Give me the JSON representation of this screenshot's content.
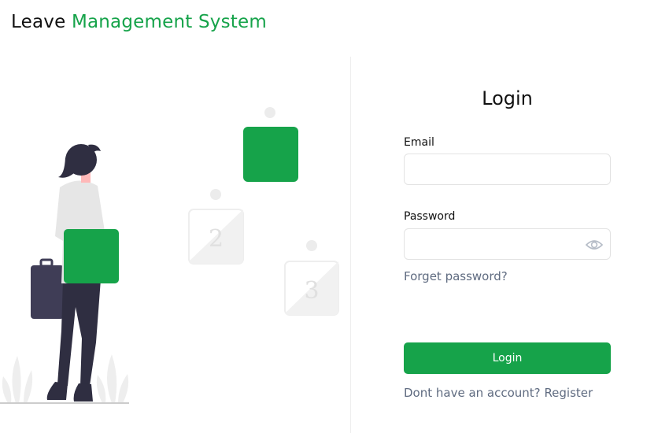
{
  "brand": {
    "part1": "Leave",
    "part2": "Management System",
    "accent_color": "#16a34a"
  },
  "illustration": {
    "step_numbers": [
      "2",
      "3"
    ]
  },
  "login": {
    "title": "Login",
    "email_label": "Email",
    "email_value": "",
    "password_label": "Password",
    "password_value": "",
    "show_password_icon": "eye-icon",
    "forget_password": "Forget password?",
    "submit_label": "Login",
    "no_account_text": "Dont have an account?",
    "register_link": "Register"
  }
}
